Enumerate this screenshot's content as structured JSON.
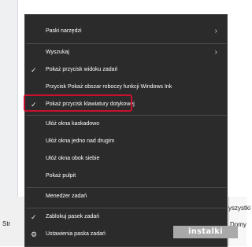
{
  "background": {
    "right_top_text": "yszystki",
    "left_text": "Str",
    "right_bottom_text": "Domy"
  },
  "menu": {
    "items": [
      {
        "label": "Paski narzędzi",
        "checked": false,
        "submenu": true
      },
      {
        "label": "Wyszukaj",
        "checked": false,
        "submenu": true
      },
      {
        "label": "Pokaż przycisk widoku zadań",
        "checked": true,
        "submenu": false
      },
      {
        "label": "Przycisk Pokaż obszar roboczy funkcji Windows Ink",
        "checked": false,
        "submenu": false
      },
      {
        "label": "Pokaż przycisk klawiatury dotykowej",
        "checked": true,
        "submenu": false,
        "highlighted": true
      },
      {
        "label": "Ułóż okna kaskadowo",
        "checked": false,
        "submenu": false
      },
      {
        "label": "Ułóż okna jedno nad drugim",
        "checked": false,
        "submenu": false
      },
      {
        "label": "Ułóż okna obok siebie",
        "checked": false,
        "submenu": false
      },
      {
        "label": "Pokaż pulpit",
        "checked": false,
        "submenu": false
      },
      {
        "label": "Menedżer zadań",
        "checked": false,
        "submenu": false
      },
      {
        "label": "Zablokuj pasek zadań",
        "checked": true,
        "submenu": false
      },
      {
        "label": "Ustawienia paska zadań",
        "checked": false,
        "submenu": false,
        "icon": "gear-icon"
      }
    ],
    "check_glyph": "✓",
    "arrow_glyph": "›",
    "gear_glyph": "⚙"
  },
  "colors": {
    "menu_bg": "#2b2b2b",
    "highlight_border": "#c8102e"
  },
  "watermark": "instalki"
}
